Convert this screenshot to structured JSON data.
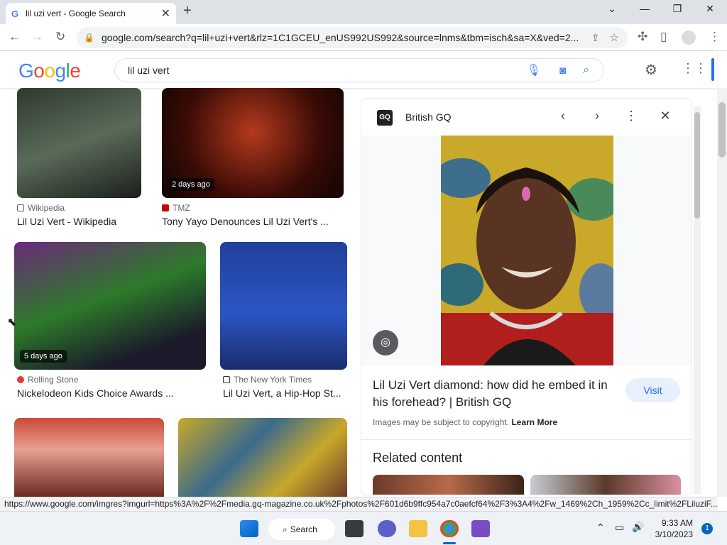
{
  "browser": {
    "tab_title": "lil uzi vert - Google Search",
    "url": "google.com/search?q=lil+uzi+vert&rlz=1C1GCEU_enUS992US992&source=lnms&tbm=isch&sa=X&ved=2..."
  },
  "google": {
    "logo": "Google",
    "query": "lil uzi vert"
  },
  "results": [
    {
      "source": "Wikipedia",
      "caption": "Lil Uzi Vert - Wikipedia",
      "badge": ""
    },
    {
      "source": "TMZ",
      "caption": "Tony Yayo Denounces Lil Uzi Vert's ...",
      "badge": "2 days ago"
    },
    {
      "source": "Rolling Stone",
      "caption": "Nickelodeon Kids Choice Awards ...",
      "badge": "5 days ago"
    },
    {
      "source": "The New York Times",
      "caption": "Lil Uzi Vert, a Hip-Hop St...",
      "badge": ""
    }
  ],
  "panel": {
    "source": "British GQ",
    "logo_text": "GQ",
    "title": "Lil Uzi Vert diamond: how did he embed it in his forehead? | British GQ",
    "visit_label": "Visit",
    "copyright": "Images may be subject to copyright.",
    "learn_more": "Learn More",
    "related": "Related content"
  },
  "status_url": "https://www.google.com/imgres?imgurl=https%3A%2F%2Fmedia.gq-magazine.co.uk%2Fphotos%2F601d6b9ffc954a7c0aefcf64%2F3%3A4%2Fw_1469%2Ch_1959%2Cc_limit%2FLiluziF...",
  "taskbar": {
    "search_label": "Search",
    "time": "9:33 AM",
    "date": "3/10/2023",
    "notifications": "1"
  },
  "colors": {
    "accent": "#1a73e8",
    "tabstrip": "#dee1e6"
  }
}
